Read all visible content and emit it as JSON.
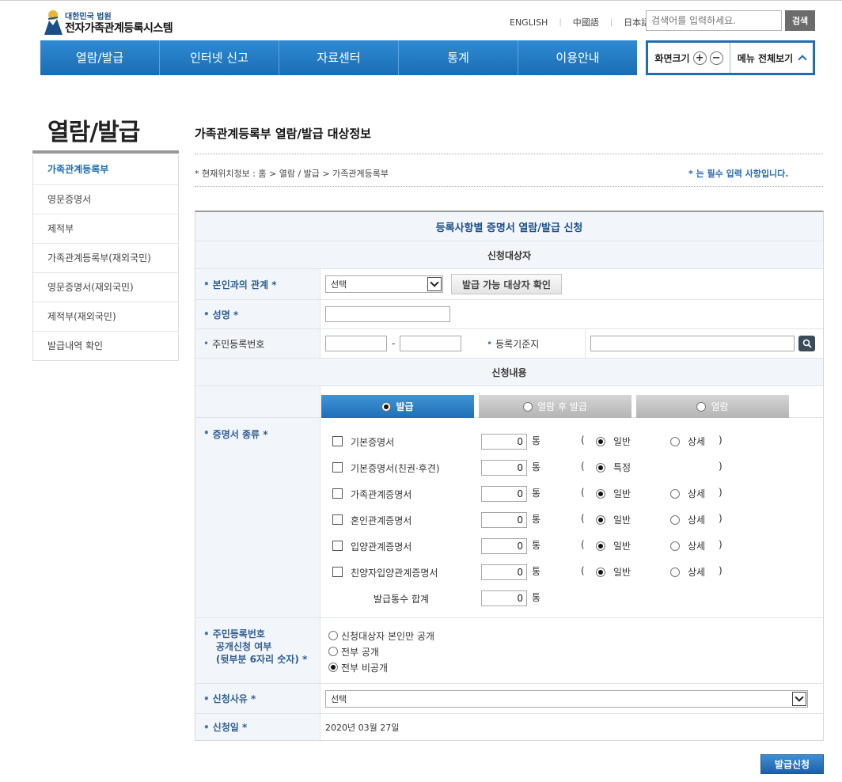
{
  "header": {
    "logo_sub": "대한민국 법원",
    "logo_main": "전자가족관계등록시스템",
    "languages": [
      "ENGLISH",
      "中國語",
      "日本語"
    ],
    "search_placeholder": "검색어를 입력하세요.",
    "search_button": "검색",
    "nav": [
      "열람/발급",
      "인터넷 신고",
      "자료센터",
      "통계",
      "이용안내"
    ],
    "screen_size_label": "화면크기",
    "zoom_in": "+",
    "zoom_out": "−",
    "menu_all_label": "메뉴 전체보기"
  },
  "sidebar": {
    "title": "열람/발급",
    "items": [
      "가족관계등록부",
      "영문증명서",
      "제적부",
      "가족관계등록부(재외국민)",
      "영문증명서(재외국민)",
      "제적부(재외국민)",
      "발급내역 확인"
    ],
    "active_index": 0
  },
  "content": {
    "title": "가족관계등록부 열람/발급 대상정보",
    "location": "* 현재위치정보 : 홈 > 열람 / 발급 > 가족관계등록부",
    "required_note": "* 는 필수 입력 사항입니다."
  },
  "form": {
    "main_heading": "등록사항별 증명서 열람/발급 신청",
    "target_heading": "신청대상자",
    "relation_label": "본인과의 관계 *",
    "relation_select": "선택",
    "check_target_button": "발급 가능 대상자 확인",
    "name_label": "성명 *",
    "rrn_label": "주민등록번호",
    "rrn_dash": "-",
    "base_addr_label": "등록기준지",
    "content_heading": "신청내용",
    "tabs": [
      "발급",
      "열람 후 발급",
      "열람"
    ],
    "active_tab": 0,
    "cert_type_label": "증명서 종류 *",
    "unit": "통",
    "open_paren": "(",
    "close_paren": ")",
    "option_general": "일반",
    "option_detail": "상세",
    "option_special": "특정",
    "certificates": [
      {
        "name": "기본증명서",
        "count": "0"
      },
      {
        "name": "기본증명서(친권·후견)",
        "count": "0"
      },
      {
        "name": "가족관계증명서",
        "count": "0"
      },
      {
        "name": "혼인관계증명서",
        "count": "0"
      },
      {
        "name": "입양관계증명서",
        "count": "0"
      },
      {
        "name": "친양자입양관계증명서",
        "count": "0"
      }
    ],
    "total_label": "발급통수 합계",
    "total_count": "0",
    "rrn_disclosure_label": [
      "주민등록번호",
      "공개신청 여부",
      "(뒷부분 6자리 숫자) *"
    ],
    "rrn_disclosure_options": [
      "신청대상자 본인만 공개",
      "전부 공개",
      "전부 비공개"
    ],
    "rrn_disclosure_selected": 2,
    "reason_label": "신청사유 *",
    "reason_select": "선택",
    "date_label": "신청일 *",
    "date_value": "2020년 03월 27일",
    "submit_button": "발급신청"
  },
  "colors": {
    "nav_blue": "#1a6db5",
    "label_bg": "#f2f6fa",
    "label_text": "#2f5e94"
  }
}
